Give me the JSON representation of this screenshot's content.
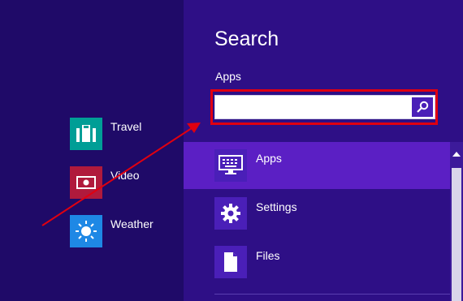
{
  "left": {
    "tiles": [
      {
        "label": "Travel",
        "icon": "suitcase-icon",
        "color": "#009e96"
      },
      {
        "label": "Video",
        "icon": "video-icon",
        "color": "#b01a3c"
      },
      {
        "label": "Weather",
        "icon": "sun-icon",
        "color": "#1e88e5"
      }
    ]
  },
  "search_pane": {
    "title": "Search",
    "scope": "Apps",
    "input": {
      "value": "",
      "placeholder": ""
    },
    "button_icon": "magnifier-icon",
    "items": [
      {
        "label": "Apps",
        "icon": "keyboard-icon",
        "selected": true
      },
      {
        "label": "Settings",
        "icon": "gear-icon",
        "selected": false
      },
      {
        "label": "Files",
        "icon": "file-icon",
        "selected": false
      }
    ]
  },
  "colors": {
    "background": "#1f0a68",
    "pane": "#2e0f86",
    "accent": "#4a1fb8",
    "selected": "#5b1fc4",
    "annotation": "#e00010"
  }
}
